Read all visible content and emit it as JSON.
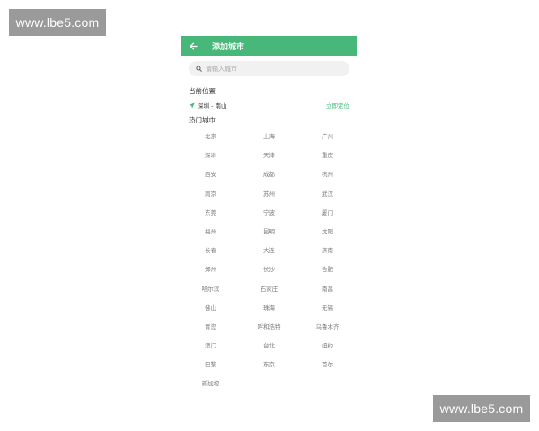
{
  "watermark": {
    "text": "www.lbe5.com"
  },
  "header": {
    "title": "添加城市"
  },
  "search": {
    "placeholder": "请输入城市"
  },
  "current_location": {
    "title": "当前位置",
    "value": "深圳 - 南山",
    "locate_label": "立即定位"
  },
  "hot_cities": {
    "title": "热门城市",
    "items": [
      "北京",
      "上海",
      "广州",
      "深圳",
      "天津",
      "重庆",
      "西安",
      "成都",
      "杭州",
      "南京",
      "苏州",
      "武汉",
      "东莞",
      "宁波",
      "厦门",
      "福州",
      "昆明",
      "沈阳",
      "长春",
      "大连",
      "济南",
      "郑州",
      "长沙",
      "合肥",
      "哈尔滨",
      "石家庄",
      "南昌",
      "佛山",
      "珠海",
      "无锡",
      "青岛",
      "呼和浩特",
      "乌鲁木齐",
      "澳门",
      "台北",
      "纽约",
      "巴黎",
      "东京",
      "首尔",
      "新加坡"
    ]
  },
  "colors": {
    "accent": "#47b879",
    "watermark_bg": "#9a9a9a"
  },
  "icons": {
    "back": "arrow-left-icon",
    "search": "search-icon",
    "location": "navigation-arrow-icon"
  }
}
